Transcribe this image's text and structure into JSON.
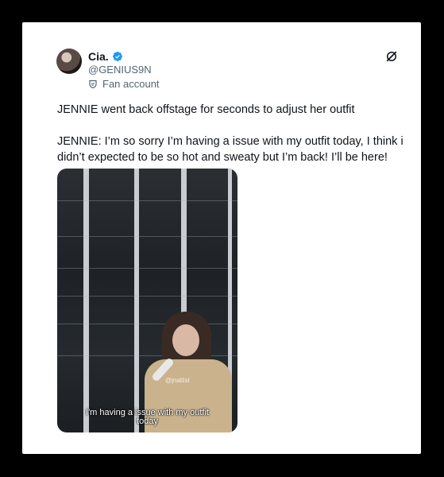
{
  "tweet": {
    "author_name": "Cia.",
    "author_handle": "@GENIUS9N",
    "account_label": "Fan account",
    "text": "JENNIE went back offstage for seconds to adjust her outfit\n\nJENNIE: I’m so sorry I’m having a issue with my outfit today, I think i didn’t expected to be so hot and sweaty but I’m back! I’ll be here!"
  },
  "media": {
    "watermark": "@jnatlist",
    "caption_line1": "I'm having a issue with my outfit",
    "caption_line2": "today"
  },
  "colors": {
    "verified_blue": "#1d9bf0",
    "text_primary": "#0f1419",
    "text_secondary": "#536471"
  },
  "icons": [
    "verified-badge-icon",
    "fan-account-icon",
    "grok-icon"
  ]
}
